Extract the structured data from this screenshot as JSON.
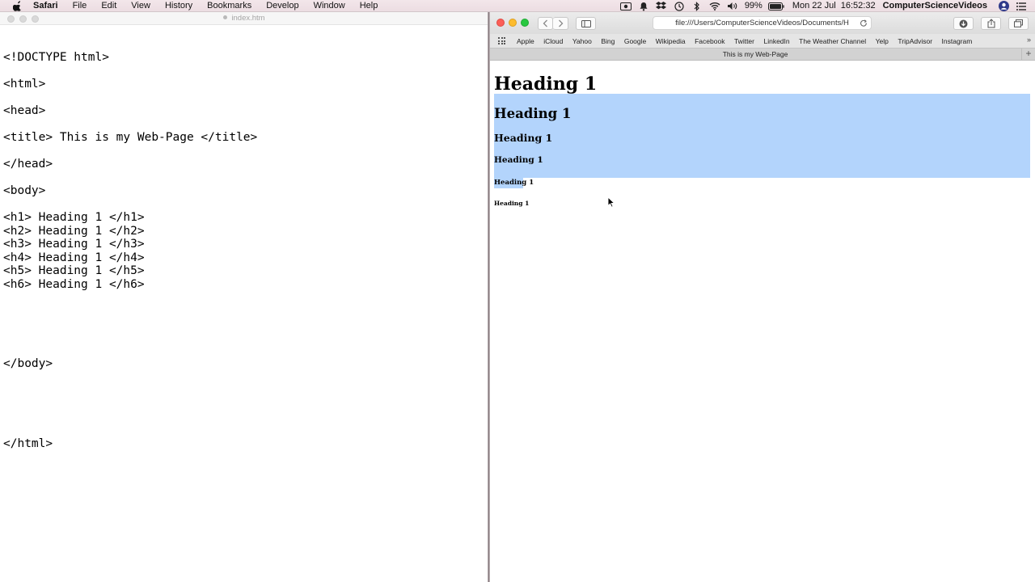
{
  "menubar": {
    "items": [
      "Safari",
      "File",
      "Edit",
      "View",
      "History",
      "Bookmarks",
      "Develop",
      "Window",
      "Help"
    ],
    "battery": "99%",
    "clock": "Mon 22 Jul  16:52:32",
    "user": "ComputerScienceVideos"
  },
  "editor": {
    "title": "index.htm",
    "lines": [
      "<!DOCTYPE html>",
      "<html>",
      "<head>",
      "<title> This is my Web-Page </title>",
      "</head>",
      "<body>",
      "<h1> Heading 1 </h1>",
      "<h2> Heading 1 </h2>",
      "<h3> Heading 1 </h3>",
      "<h4> Heading 1 </h4>",
      "<h5> Heading 1 </h5>",
      "<h6> Heading 1 </h6>",
      "</body>",
      "</html>"
    ]
  },
  "safari": {
    "url": "file:///Users/ComputerScienceVideos/Documents/H",
    "favorites": [
      "Apple",
      "iCloud",
      "Yahoo",
      "Bing",
      "Google",
      "Wikipedia",
      "Facebook",
      "Twitter",
      "LinkedIn",
      "The Weather Channel",
      "Yelp",
      "TripAdvisor",
      "Instagram"
    ],
    "tab_title": "This is my Web-Page",
    "headings": [
      "Heading 1",
      "Heading 1",
      "Heading 1",
      "Heading 1",
      "Heading 1",
      "Heading 1"
    ]
  },
  "colors": {
    "selection": "#b3d4fc",
    "close": "#fc5f57",
    "minimize": "#fdbc2e",
    "zoom": "#28c840"
  }
}
